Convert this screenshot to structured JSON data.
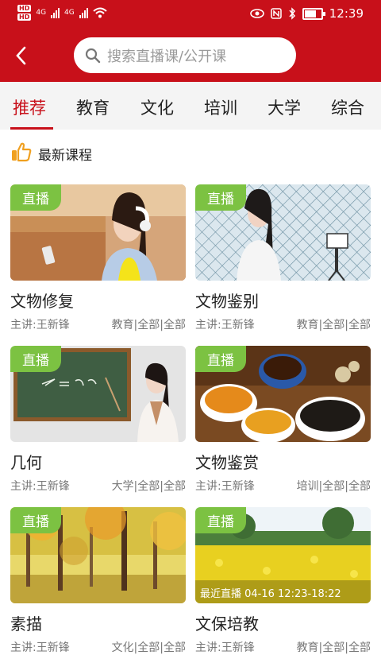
{
  "status_bar": {
    "hd1": "HD",
    "hd2": "HD",
    "net1": "4G",
    "net2": "4G",
    "time": "12:39",
    "battery_level": 0.8
  },
  "search": {
    "placeholder": "搜索直播课/公开课"
  },
  "tabs": [
    "推荐",
    "教育",
    "文化",
    "培训",
    "大学",
    "综合"
  ],
  "section": {
    "title": "最新课程"
  },
  "cards": [
    {
      "badge": "直播",
      "title": "文物修复",
      "lecturer": "主讲:王新锋",
      "category": "教育|全部|全部"
    },
    {
      "badge": "直播",
      "title": "文物鉴别",
      "lecturer": "主讲:王新锋",
      "category": "教育|全部|全部"
    },
    {
      "badge": "直播",
      "title": "几何",
      "lecturer": "主讲:王新锋",
      "category": "大学|全部|全部"
    },
    {
      "badge": "直播",
      "title": "文物鉴赏",
      "lecturer": "主讲:王新锋",
      "category": "培训|全部|全部"
    },
    {
      "badge": "直播",
      "title": "素描",
      "lecturer": "主讲:王新锋",
      "category": "文化|全部|全部"
    },
    {
      "badge": "直播",
      "title": "文保培教",
      "lecturer": "主讲:王新锋",
      "category": "教育|全部|全部",
      "overlay": "最近直播 04-16 12:23-18:22"
    }
  ],
  "colors": {
    "brand": "#c8101a",
    "badge": "#7cc242"
  },
  "icons": {
    "back": "back-arrow-icon",
    "search": "search-icon",
    "thumb": "thumbs-up-icon"
  }
}
